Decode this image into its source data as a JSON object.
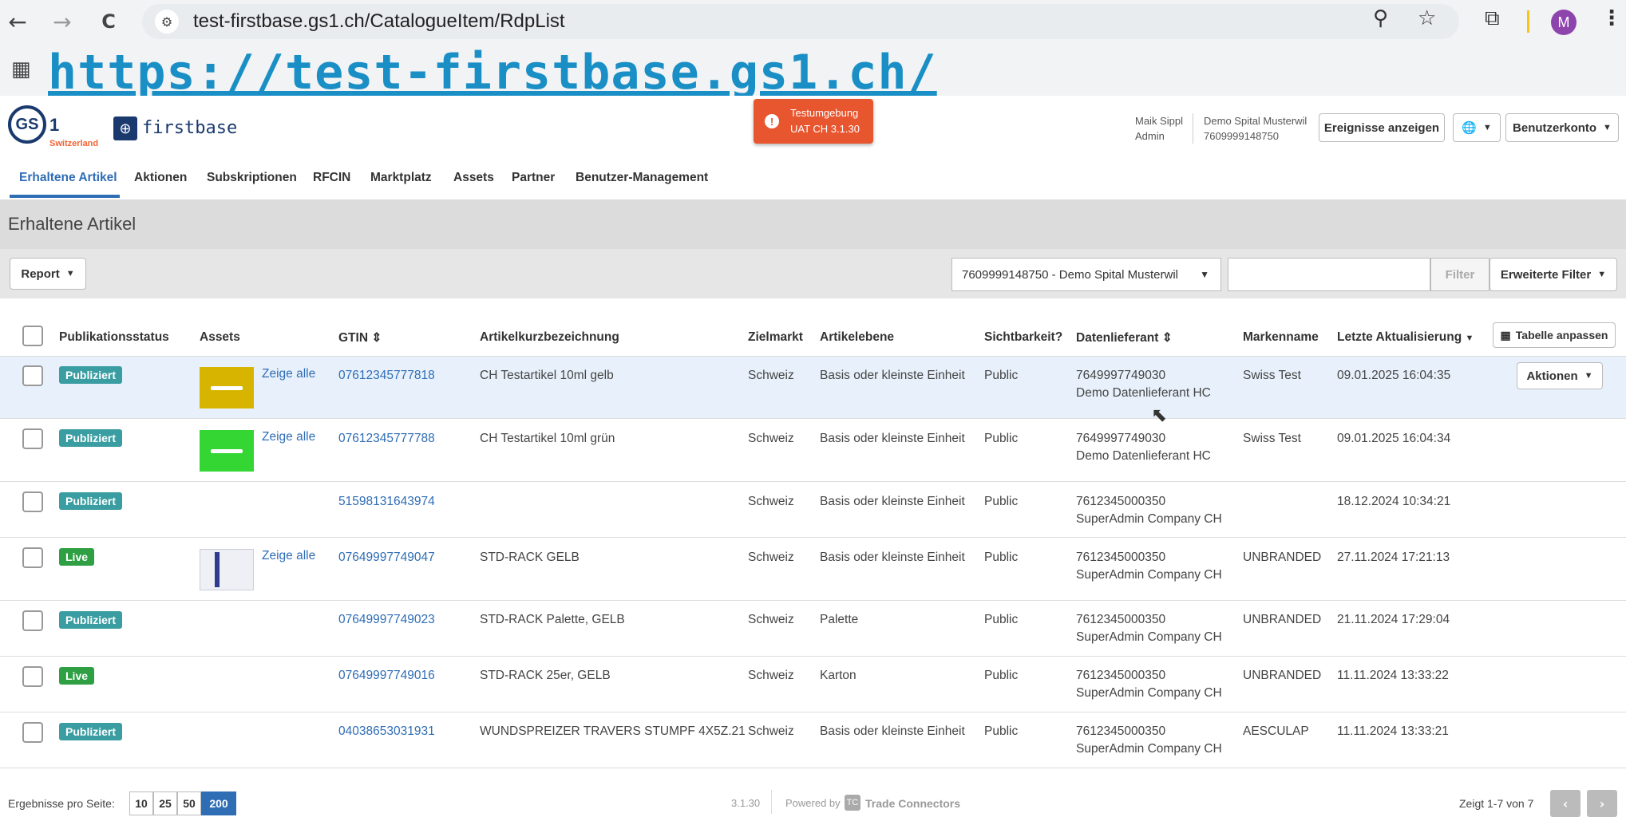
{
  "browser": {
    "back_icon": "←",
    "forward_icon": "→",
    "reload_icon": "C",
    "url": "test-firstbase.gs1.ch/CatalogueItem/RdpList",
    "avatar_letter": "M",
    "bookmark_link": "https://test-firstbase.gs1.ch/"
  },
  "header": {
    "gs1_text": "GS",
    "gs1_one": "1",
    "gs1_country": "Switzerland",
    "firstbase": "firstbase",
    "env_line1": "Testumgebung",
    "env_line2": "UAT CH 3.1.30",
    "user_name": "Maik Sippl",
    "user_role": "Admin",
    "company_name": "Demo Spital Musterwil",
    "company_gln": "7609999148750",
    "events_button": "Ereignisse anzeigen",
    "account_button": "Benutzerkonto"
  },
  "tabs": [
    "Erhaltene Artikel",
    "Aktionen",
    "Subskriptionen",
    "RFCIN",
    "Marktplatz",
    "Assets",
    "Partner",
    "Benutzer-Management"
  ],
  "page": {
    "title": "Erhaltene Artikel",
    "report_button": "Report",
    "partner_select": "7609999148750 - Demo Spital Musterwil",
    "filter_button": "Filter",
    "advanced_filter_button": "Erweiterte Filter",
    "customize_table_button": "Tabelle anpassen",
    "actions_button": "Aktionen"
  },
  "columns": {
    "status": "Publikationsstatus",
    "assets": "Assets",
    "gtin": "GTIN",
    "name": "Artikelkurzbezeichnung",
    "market": "Zielmarkt",
    "level": "Artikelebene",
    "visibility": "Sichtbarkeit?",
    "supplier": "Datenlieferant",
    "brand": "Markenname",
    "updated": "Letzte Aktualisierung"
  },
  "rows": [
    {
      "status": "Publiziert",
      "assets": "Zeige alle",
      "gtin": "07612345777818",
      "name": "CH Testartikel 10ml gelb",
      "market": "Schweiz",
      "level": "Basis oder kleinste Einheit",
      "visibility": "Public",
      "supplier_gln": "7649997749030",
      "supplier_name": "Demo Datenlieferant HC",
      "brand": "Swiss Test",
      "updated": "09.01.2025 16:04:35"
    },
    {
      "status": "Publiziert",
      "assets": "Zeige alle",
      "gtin": "07612345777788",
      "name": "CH Testartikel 10ml grün",
      "market": "Schweiz",
      "level": "Basis oder kleinste Einheit",
      "visibility": "Public",
      "supplier_gln": "7649997749030",
      "supplier_name": "Demo Datenlieferant HC",
      "brand": "Swiss Test",
      "updated": "09.01.2025 16:04:34"
    },
    {
      "status": "Publiziert",
      "assets": "",
      "gtin": "51598131643974",
      "name": "",
      "market": "Schweiz",
      "level": "Basis oder kleinste Einheit",
      "visibility": "Public",
      "supplier_gln": "7612345000350",
      "supplier_name": "SuperAdmin Company CH",
      "brand": "",
      "updated": "18.12.2024 10:34:21"
    },
    {
      "status": "Live",
      "assets": "Zeige alle",
      "gtin": "07649997749047",
      "name": "STD-RACK GELB",
      "market": "Schweiz",
      "level": "Basis oder kleinste Einheit",
      "visibility": "Public",
      "supplier_gln": "7612345000350",
      "supplier_name": "SuperAdmin Company CH",
      "brand": "UNBRANDED",
      "updated": "27.11.2024 17:21:13"
    },
    {
      "status": "Publiziert",
      "assets": "",
      "gtin": "07649997749023",
      "name": "STD-RACK Palette, GELB",
      "market": "Schweiz",
      "level": "Palette",
      "visibility": "Public",
      "supplier_gln": "7612345000350",
      "supplier_name": "SuperAdmin Company CH",
      "brand": "UNBRANDED",
      "updated": "21.11.2024 17:29:04"
    },
    {
      "status": "Live",
      "assets": "",
      "gtin": "07649997749016",
      "name": "STD-RACK 25er, GELB",
      "market": "Schweiz",
      "level": "Karton",
      "visibility": "Public",
      "supplier_gln": "7612345000350",
      "supplier_name": "SuperAdmin Company CH",
      "brand": "UNBRANDED",
      "updated": "11.11.2024 13:33:22"
    },
    {
      "status": "Publiziert",
      "assets": "",
      "gtin": "04038653031931",
      "name": "WUNDSPREIZER TRAVERS STUMPF 4X5Z.21",
      "market": "Schweiz",
      "level": "Basis oder kleinste Einheit",
      "visibility": "Public",
      "supplier_gln": "7612345000350",
      "supplier_name": "SuperAdmin Company CH",
      "brand": "AESCULAP",
      "updated": "11.11.2024 13:33:21"
    }
  ],
  "footer": {
    "per_page_label": "Ergebnisse pro Seite:",
    "per_page_options": [
      "10",
      "25",
      "50",
      "200"
    ],
    "per_page_selected": "200",
    "version": "3.1.30",
    "powered_by": "Powered by",
    "powered_name": "Trade Connectors",
    "range": "Zeigt 1-7 von 7"
  },
  "colors": {
    "accent": "#2f6db5",
    "published": "#3a9da1",
    "live": "#2ea043",
    "env_badge": "#e8562f"
  }
}
